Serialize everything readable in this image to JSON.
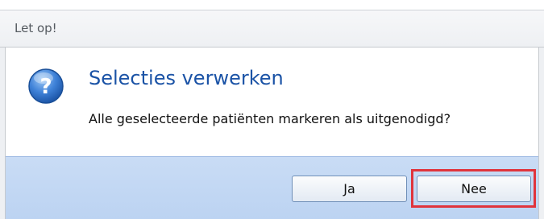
{
  "window": {
    "title": "Let op!"
  },
  "dialog": {
    "icon": "question-icon",
    "heading": "Selecties verwerken",
    "message": "Alle geselecteerde patiënten markeren als uitgenodigd?"
  },
  "buttons": {
    "yes_label": "Ja",
    "no_label": "Nee"
  },
  "colors": {
    "heading": "#1b53a6",
    "footer": "#c9dcf5",
    "highlight": "#e0343c"
  }
}
